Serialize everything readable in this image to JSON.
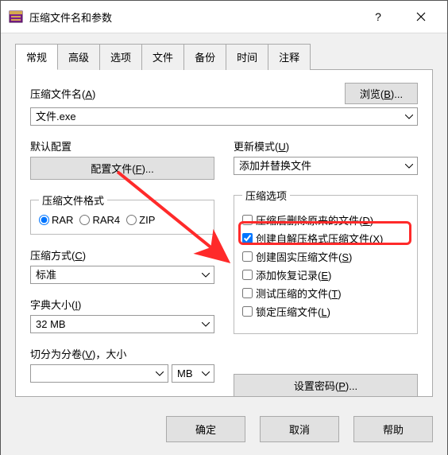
{
  "window": {
    "title": "压缩文件名和参数"
  },
  "tabs": [
    "常规",
    "高级",
    "选项",
    "文件",
    "备份",
    "时间",
    "注释"
  ],
  "activeTab": 0,
  "filename": {
    "label": "压缩文件名(A)",
    "value": "文件.exe",
    "browse": "浏览(B)..."
  },
  "profile": {
    "label": "默认配置",
    "button": "配置文件(F)..."
  },
  "updateMode": {
    "label": "更新模式(U)",
    "value": "添加并替换文件"
  },
  "format": {
    "label": "压缩文件格式",
    "options": [
      "RAR",
      "RAR4",
      "ZIP"
    ],
    "selected": "RAR"
  },
  "method": {
    "label": "压缩方式(C)",
    "value": "标准"
  },
  "dict": {
    "label": "字典大小(I)",
    "value": "32 MB"
  },
  "split": {
    "label": "切分为分卷(V)，大小",
    "unit": "MB"
  },
  "options": {
    "label": "压缩选项",
    "items": [
      {
        "checked": false,
        "label": "压缩后删除原来的文件(D)"
      },
      {
        "checked": true,
        "label": "创建自解压格式压缩文件(X)"
      },
      {
        "checked": false,
        "label": "创建固实压缩文件(S)"
      },
      {
        "checked": false,
        "label": "添加恢复记录(E)"
      },
      {
        "checked": false,
        "label": "测试压缩的文件(T)"
      },
      {
        "checked": false,
        "label": "锁定压缩文件(L)"
      }
    ]
  },
  "password": {
    "button": "设置密码(P)..."
  },
  "footer": {
    "ok": "确定",
    "cancel": "取消",
    "help": "帮助"
  }
}
